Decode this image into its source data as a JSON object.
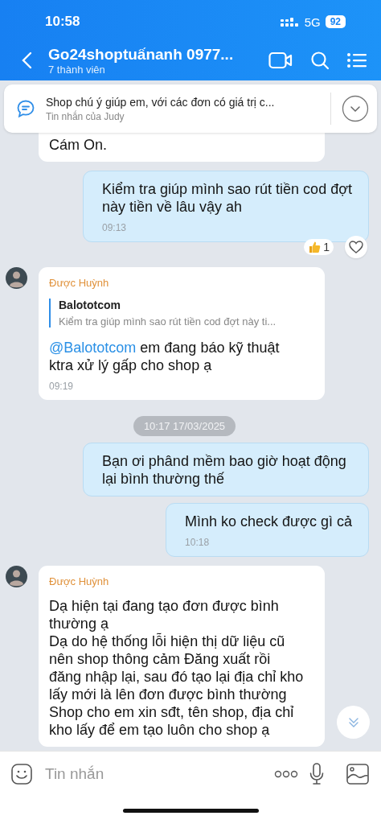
{
  "status_bar": {
    "time": "10:58",
    "network": "5G",
    "battery": "92"
  },
  "header": {
    "title": "Go24shoptuấnanh 0977...",
    "subtitle": "7 thành viên"
  },
  "pinned": {
    "text": "Shop chú ý giúp em, với các đơn có giá trị c...",
    "sender": "Tin nhắn của Judy"
  },
  "messages": [
    {
      "kind": "incoming",
      "avatar": false,
      "text": "Cám On."
    },
    {
      "kind": "outgoing",
      "text": "Kiểm tra giúp mình sao rút tiền cod đợt này tiền về lâu vậy ah",
      "time": "09:13",
      "reaction": {
        "count": "1"
      }
    },
    {
      "kind": "incoming",
      "avatar": true,
      "sender": "Được Huỳnh",
      "quote": {
        "author": "Balototcom",
        "text": "Kiểm tra giúp mình sao rút tiền cod đợt này ti..."
      },
      "mention": "@Balototcom",
      "text": "em đang báo kỹ thuật ktra xử lý gấp cho shop ạ",
      "time": "09:19"
    },
    {
      "kind": "date",
      "text": "10:17 17/03/2025"
    },
    {
      "kind": "outgoing",
      "text": "Bạn ơi phând mềm bao giờ hoạt động lại bình thường thế"
    },
    {
      "kind": "outgoing",
      "text": "Mình ko check được gì cả",
      "time": "10:18"
    },
    {
      "kind": "incoming",
      "avatar": true,
      "sender": "Được Huỳnh",
      "text": "Dạ hiện tại đang tạo đơn được bình thường ạ\nDạ do hệ thống lỗi hiện thị dữ liệu cũ nên shop thông cảm Đăng xuất rồi đăng nhập lại, sau đó tạo lại địa chỉ kho lấy mới là lên đơn được bình thường\nShop cho em xin sđt, tên shop, địa chỉ kho lấy để em tạo luôn cho shop ạ"
    }
  ],
  "composer": {
    "placeholder": "Tin nhắn"
  }
}
